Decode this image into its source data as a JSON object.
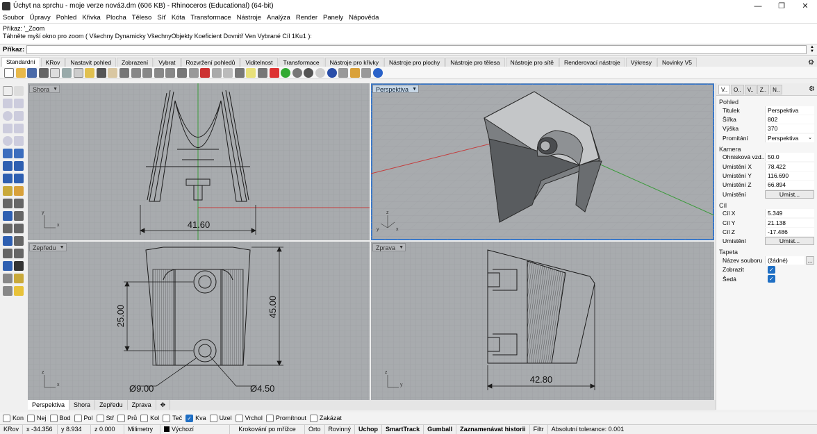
{
  "window": {
    "title": "Úchyt na sprchu - moje verze nová3.dm (606 KB) - Rhinoceros (Educational) (64-bit)"
  },
  "menu": [
    "Soubor",
    "Úpravy",
    "Pohled",
    "Křivka",
    "Plocha",
    "Těleso",
    "Síť",
    "Kóta",
    "Transformace",
    "Nástroje",
    "Analýza",
    "Render",
    "Panely",
    "Nápověda"
  ],
  "history": {
    "line1": "Příkaz: '_Zoom",
    "line2": "Táhněte myší okno pro zoom ( Všechny  Dynamicky  VšechnyObjekty  Koeficient  Dovnitř  Ven  Vybrané  Cíl  1Ku1 ):"
  },
  "command": {
    "label": "Příkaz:",
    "value": ""
  },
  "tabs": [
    "Standardní",
    "KRov",
    "Nastavit pohled",
    "Zobrazení",
    "Vybrat",
    "Rozvržení pohledů",
    "Viditelnost",
    "Transformace",
    "Nástroje pro křivky",
    "Nástroje pro plochy",
    "Nástroje pro tělesa",
    "Nástroje pro sítě",
    "Renderovací nástroje",
    "Výkresy",
    "Novinky V5"
  ],
  "active_tab": "Standardní",
  "viewports": {
    "top": {
      "label": "Shora",
      "dim": "41.60"
    },
    "persp": {
      "label": "Perspektiva"
    },
    "front": {
      "label": "Zepředu",
      "dim_v1": "25.00",
      "dim_v2": "45.00",
      "dia1": "Ø9.00",
      "dia2": "Ø4.50"
    },
    "right": {
      "label": "Zprava",
      "dim": "42.80"
    }
  },
  "viewport_tabs": [
    "Perspektiva",
    "Shora",
    "Zepředu",
    "Zprava"
  ],
  "viewport_tabs_active": "Perspektiva",
  "panel": {
    "tabs": [
      "V..",
      "O..",
      "V..",
      "Z..",
      "N.."
    ],
    "view_section": "Pohled",
    "view_rows": [
      {
        "k": "Titulek",
        "v": "Perspektiva"
      },
      {
        "k": "Šířka",
        "v": "802"
      },
      {
        "k": "Výška",
        "v": "370"
      },
      {
        "k": "Promítání",
        "v": "Perspektiva"
      }
    ],
    "camera_section": "Kamera",
    "camera_rows": [
      {
        "k": "Ohnisková vzd...",
        "v": "50.0"
      },
      {
        "k": "Umístění X",
        "v": "78.422"
      },
      {
        "k": "Umístění Y",
        "v": "116.690"
      },
      {
        "k": "Umístění Z",
        "v": "66.894"
      }
    ],
    "camera_place": {
      "k": "Umístění",
      "btn": "Umíst..."
    },
    "target_section": "Cíl",
    "target_rows": [
      {
        "k": "Cíl X",
        "v": "5.349"
      },
      {
        "k": "Cíl Y",
        "v": "21.138"
      },
      {
        "k": "Cíl Z",
        "v": "-17.486"
      }
    ],
    "target_place": {
      "k": "Umístění",
      "btn": "Umíst..."
    },
    "wallpaper_section": "Tapeta",
    "file": {
      "k": "Název souboru",
      "v": "(žádné)"
    },
    "show": {
      "k": "Zobrazit"
    },
    "gray": {
      "k": "Šedá"
    }
  },
  "osnaps": [
    {
      "label": "Kon",
      "on": false
    },
    {
      "label": "Nej",
      "on": false
    },
    {
      "label": "Bod",
      "on": false
    },
    {
      "label": "Pol",
      "on": false
    },
    {
      "label": "Stř",
      "on": false
    },
    {
      "label": "Prů",
      "on": false
    },
    {
      "label": "Kol",
      "on": false
    },
    {
      "label": "Teč",
      "on": false
    },
    {
      "label": "Kva",
      "on": true
    },
    {
      "label": "Uzel",
      "on": false
    },
    {
      "label": "Vrchol",
      "on": false
    },
    {
      "label": "Promítnout",
      "on": false
    },
    {
      "label": "Zakázat",
      "on": false
    }
  ],
  "status": {
    "plane": "KRov",
    "x": "x -34.356",
    "y": "y 8.934",
    "z": "z 0.000",
    "units": "Milimetry",
    "layer": "Výchozí",
    "grid": "Krokování po mřížce",
    "ortho": "Orto",
    "planar": "Rovinný",
    "osnap": "Uchop",
    "smart": "SmartTrack",
    "gumball": "Gumball",
    "history": "Zaznamenávat historii",
    "filter": "Filtr",
    "tol": "Absolutní tolerance: 0.001"
  }
}
